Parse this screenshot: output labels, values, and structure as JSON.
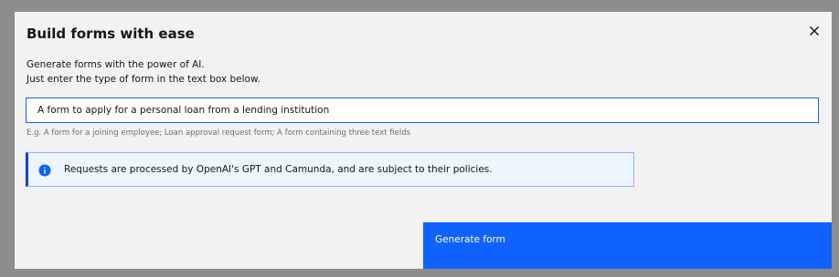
{
  "modal": {
    "title": "Build forms with ease",
    "description_line1": "Generate forms with the power of AI.",
    "description_line2": "Just enter the type of form in the text box below.",
    "input_value": "A form to apply for a personal loan from a lending institution",
    "helper_text": "E.g. A form for a joining employee; Loan approval request form; A form containing three text fields",
    "notice_text": "Requests are processed by OpenAI's GPT and Camunda, and are subject to their policies.",
    "primary_button_label": "Generate form"
  },
  "icons": {
    "close": "close-icon",
    "info": "info-icon"
  },
  "colors": {
    "overlay": "#8d8d8d",
    "modal_bg": "#f2f2f2",
    "primary": "#0f62fe",
    "notice_bg": "#edf5ff",
    "notice_border": "#0043ce"
  }
}
